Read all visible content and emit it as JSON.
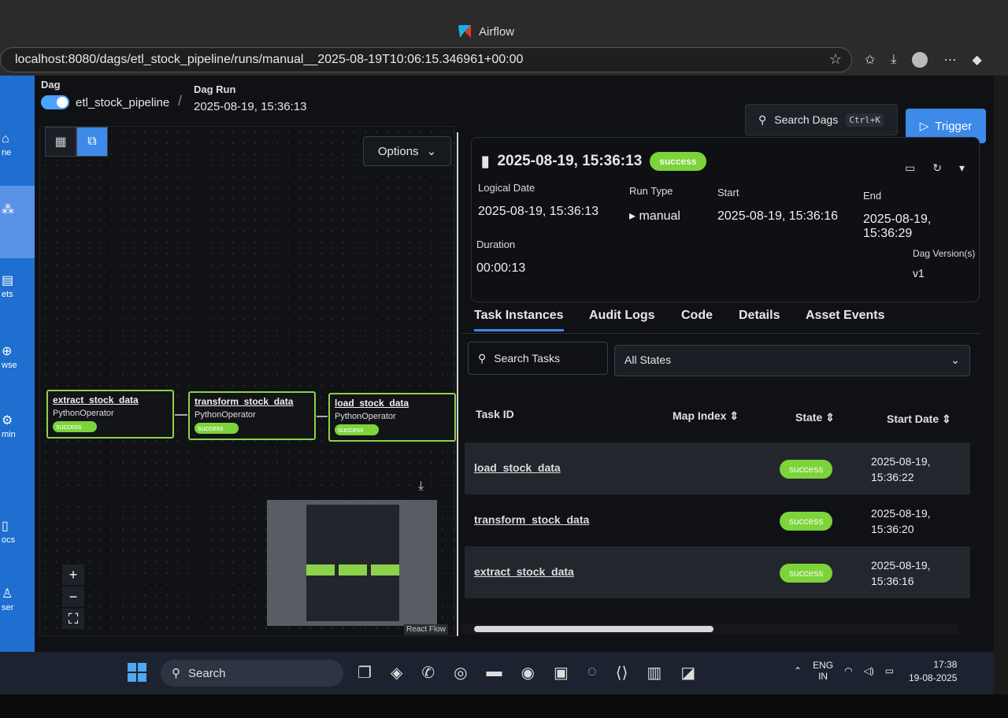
{
  "browser": {
    "window_title": "Airflow",
    "url": "localhost:8080/dags/etl_stock_pipeline/runs/manual__2025-08-19T10:06:15.346961+00:00"
  },
  "nav": [
    {
      "label": "ne",
      "icon": "home-icon"
    },
    {
      "label": "",
      "icon": "dags-icon"
    },
    {
      "label": "ets",
      "icon": "assets-icon"
    },
    {
      "label": "wse",
      "icon": "browse-icon"
    },
    {
      "label": "min",
      "icon": "admin-icon"
    },
    {
      "label": "ocs",
      "icon": "docs-icon"
    },
    {
      "label": "ser",
      "icon": "user-icon"
    }
  ],
  "header": {
    "dag_label": "Dag",
    "dag_name": "etl_stock_pipeline",
    "dagrun_label": "Dag Run",
    "dagrun_value": "2025-08-19, 15:36:13",
    "search_dags": "Search Dags",
    "search_shortcut": "Ctrl+K",
    "trigger": "Trigger"
  },
  "graph": {
    "options": "Options",
    "nodes": [
      {
        "name": "extract_stock_data",
        "operator": "PythonOperator",
        "state": "success"
      },
      {
        "name": "transform_stock_data",
        "operator": "PythonOperator",
        "state": "success"
      },
      {
        "name": "load_stock_data",
        "operator": "PythonOperator",
        "state": "success"
      }
    ],
    "react_flow": "React Flow"
  },
  "run": {
    "title": "2025-08-19, 15:36:13",
    "state": "success",
    "logical_date_label": "Logical Date",
    "logical_date": "2025-08-19, 15:36:13",
    "run_type_label": "Run Type",
    "run_type": "manual",
    "start_label": "Start",
    "start": "2025-08-19, 15:36:16",
    "end_label": "End",
    "end": "2025-08-19, 15:36:29",
    "duration_label": "Duration",
    "duration": "00:00:13",
    "version_label": "Dag Version(s)",
    "version": "v1"
  },
  "tabs": [
    "Task Instances",
    "Audit Logs",
    "Code",
    "Details",
    "Asset Events"
  ],
  "filters": {
    "search_tasks": "Search Tasks",
    "states": "All States"
  },
  "table": {
    "headers": [
      "Task ID",
      "Map Index",
      "State",
      "Start Date"
    ],
    "rows": [
      {
        "task_id": "load_stock_data",
        "state": "success",
        "start_date_1": "2025-08-19,",
        "start_date_2": "15:36:22"
      },
      {
        "task_id": "transform_stock_data",
        "state": "success",
        "start_date_1": "2025-08-19,",
        "start_date_2": "15:36:20"
      },
      {
        "task_id": "extract_stock_data",
        "state": "success",
        "start_date_1": "2025-08-19,",
        "start_date_2": "15:36:16"
      }
    ]
  },
  "taskbar": {
    "search": "Search",
    "lang_1": "ENG",
    "lang_2": "IN",
    "time": "17:38",
    "date": "19-08-2025"
  },
  "colors": {
    "accent": "#3d8ae8",
    "success": "#7dd33a",
    "nav": "#1e6fd0"
  }
}
